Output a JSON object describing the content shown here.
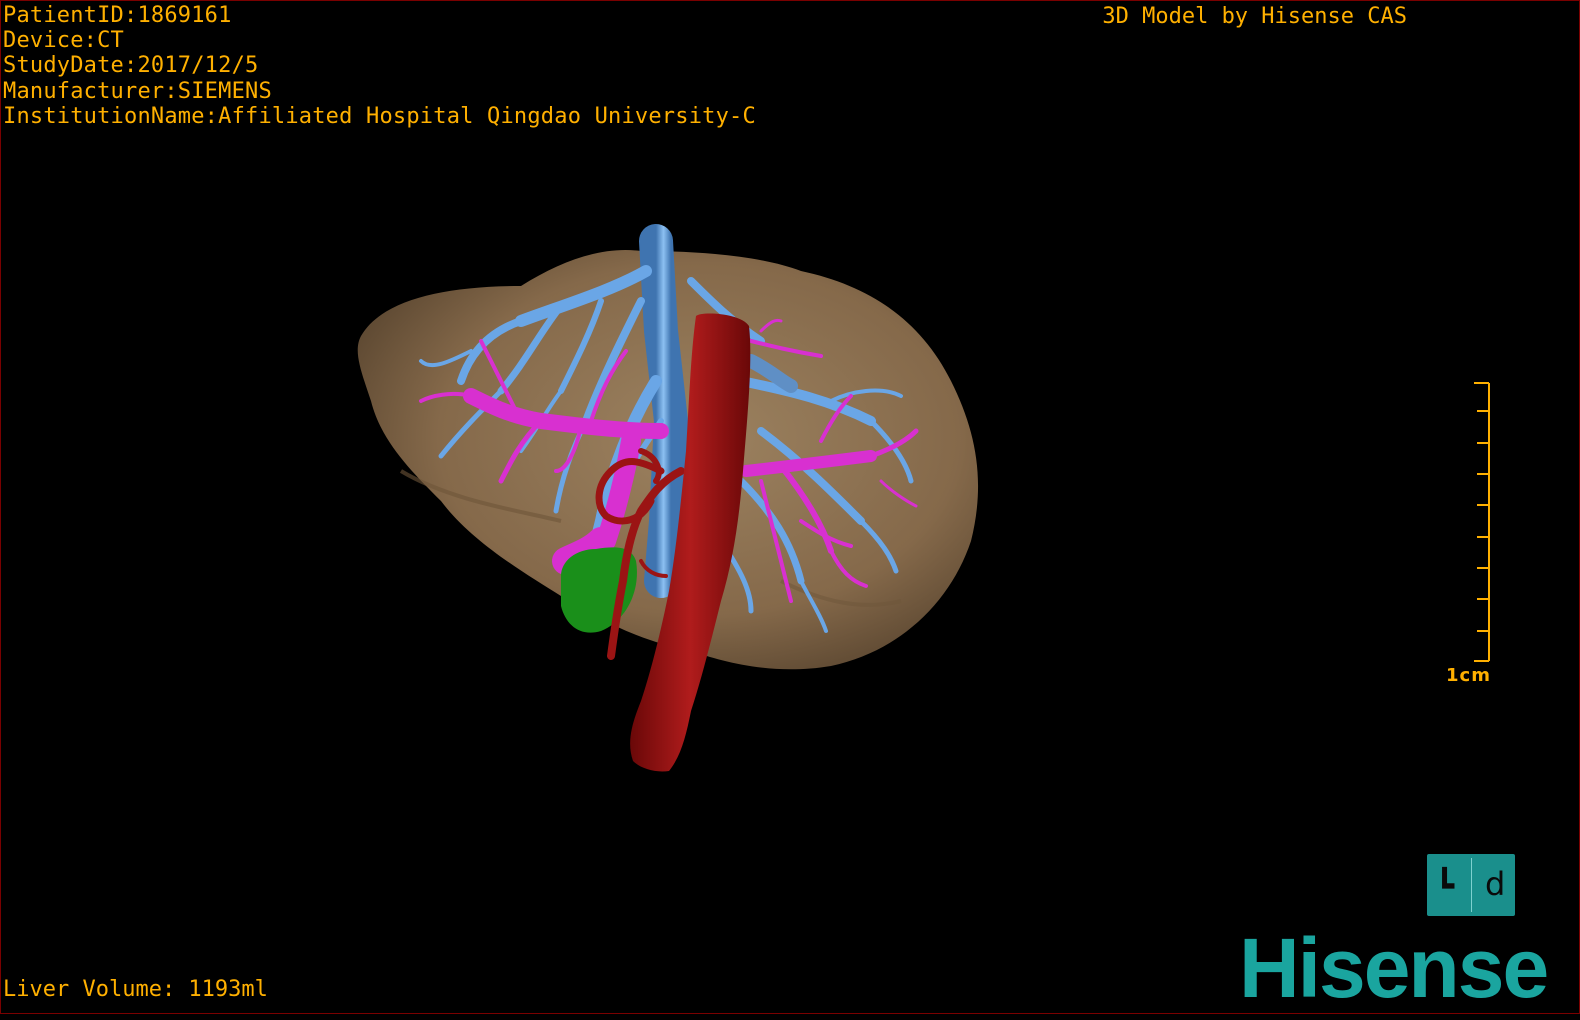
{
  "info": {
    "patient_id": "PatientID:1869161",
    "device": "Device:CT",
    "study_date": "StudyDate:2017/12/5",
    "manufacturer": "Manufacturer:SIEMENS",
    "institution": "InstitutionName:Affiliated Hospital Qingdao University-C"
  },
  "credit": "3D Model by Hisense CAS",
  "volume": "Liver Volume: 1193ml",
  "scale": {
    "label": "1cm"
  },
  "orientation": {
    "left_glyph": "┗",
    "right_glyph": "d"
  },
  "logo": "Hisense",
  "colors": {
    "overlay_text": "#ffb000",
    "liver": "#8a7152",
    "portal_vein": "#6aa6e6",
    "hepatic_artery": "#d830d0",
    "aorta": "#9b1414",
    "gallbladder": "#1a8f1a",
    "logo": "#1aa59f"
  }
}
